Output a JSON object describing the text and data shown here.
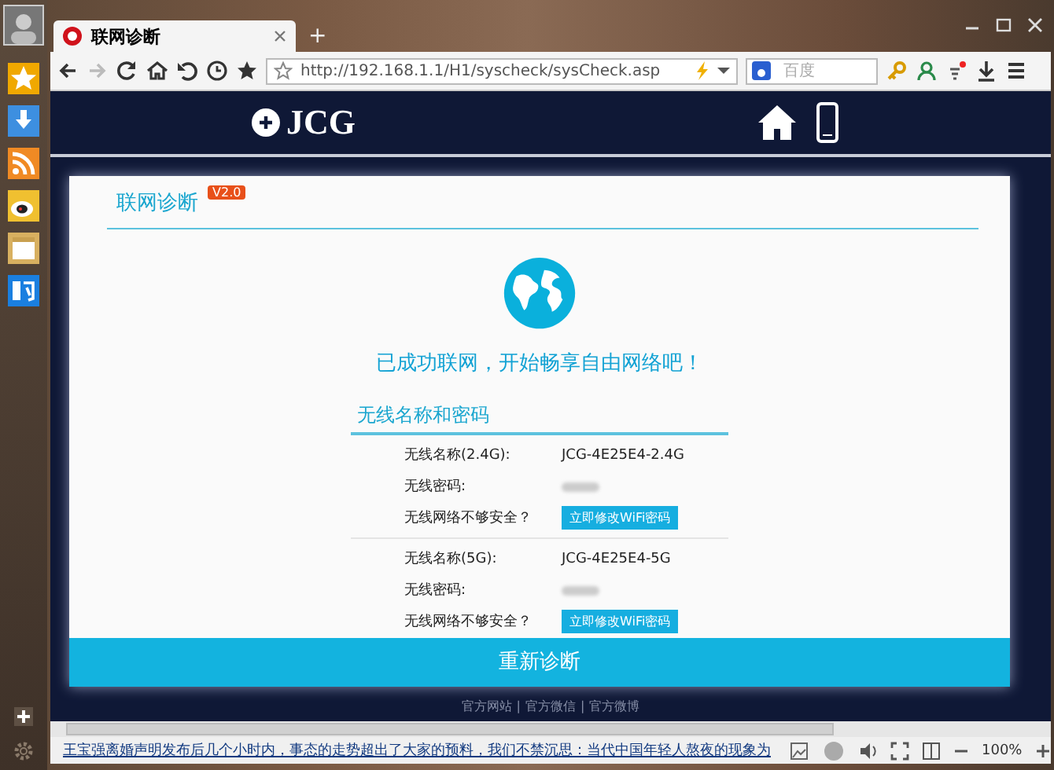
{
  "browser": {
    "tab": {
      "title": "联网诊断"
    },
    "new_tab": "+",
    "url": "http://192.168.1.1/H1/syscheck/sysCheck.asp",
    "search": {
      "placeholder": "百度"
    }
  },
  "page": {
    "logo": "JCG",
    "card_title": "联网诊断",
    "badge": "V2.0",
    "message": "已成功联网，开始畅享自由网络吧！",
    "section_title": "无线名称和密码",
    "networks": [
      {
        "rows": [
          {
            "kind": "text",
            "label": "无线名称(2.4G):",
            "value": "JCG-4E25E4-2.4G"
          },
          {
            "kind": "masked",
            "label": "无线密码:"
          },
          {
            "kind": "button",
            "label": "无线网络不够安全？",
            "value": "立即修改WiFi密码"
          }
        ]
      },
      {
        "rows": [
          {
            "kind": "text",
            "label": "无线名称(5G):",
            "value": "JCG-4E25E4-5G"
          },
          {
            "kind": "masked",
            "label": "无线密码:"
          },
          {
            "kind": "button",
            "label": "无线网络不够安全？",
            "value": "立即修改WiFi密码"
          }
        ]
      }
    ],
    "rediagnose_button": "重新诊断",
    "footer_links": [
      "官方网站",
      "官方微信",
      "官方微博"
    ],
    "footer_separator": "|"
  },
  "status_bar": {
    "news": "王宝强离婚声明发布后几个小时内，事态的走势超出了大家的预料，我们不禁沉思：当代中国年轻人熬夜的现象为",
    "zoom": "100%"
  }
}
